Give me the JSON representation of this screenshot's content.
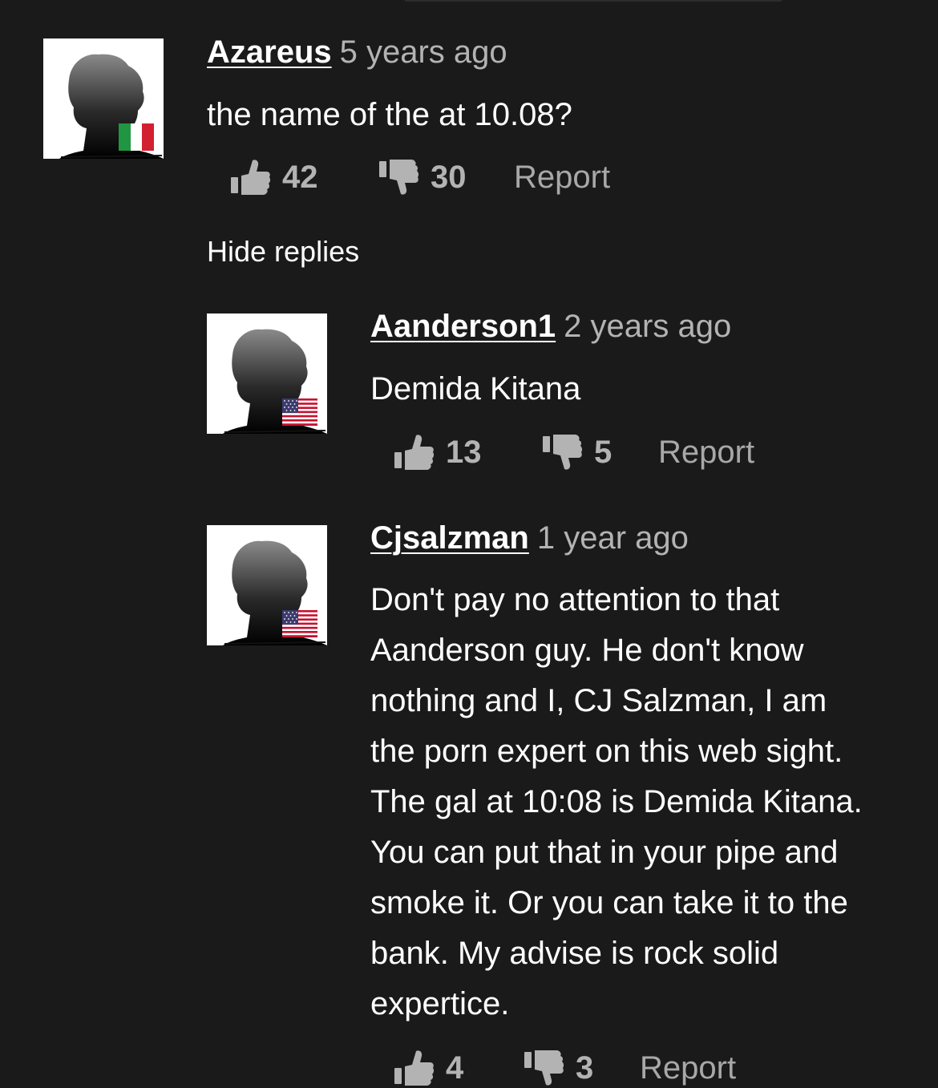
{
  "comments": [
    {
      "username": "Azareus",
      "time": "5 years ago",
      "text": "the name of the at 10.08?",
      "likes": "42",
      "dislikes": "30",
      "report_label": "Report",
      "flag": "italy-flag-icon"
    },
    {
      "username": "Aanderson1",
      "time": "2 years ago",
      "text": "Demida Kitana",
      "likes": "13",
      "dislikes": "5",
      "report_label": "Report",
      "flag": "usa-flag-icon"
    },
    {
      "username": "Cjsalzman",
      "time": "1 year ago",
      "text": "Don't pay no attention to that\nAanderson guy. He don't know\nnothing and I, CJ Salzman, I am\nthe porn expert on this web sight.\nThe gal at 10:08 is Demida Kitana.\nYou can put that in your pipe and\nsmoke it. Or you can take it to the\nbank. My advise is rock solid\nexpertice.",
      "likes": "4",
      "dislikes": "3",
      "report_label": "Report",
      "flag": "usa-flag-icon"
    }
  ],
  "hide_replies_label": "Hide replies",
  "colors": {
    "background": "#1b1a1b",
    "text": "#ffffff",
    "muted": "#b3b3b3",
    "report": "#a8a8a8"
  }
}
